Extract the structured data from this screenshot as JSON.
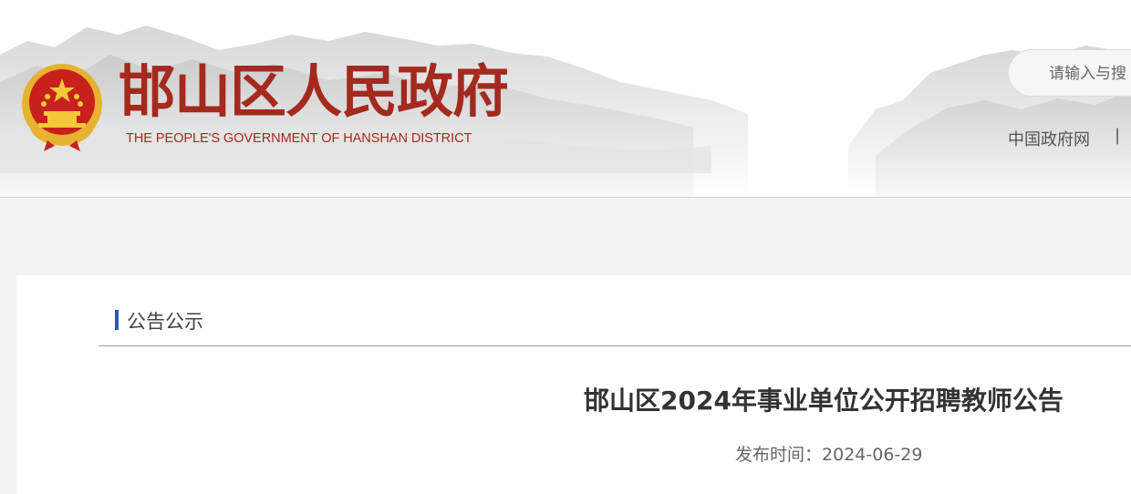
{
  "header": {
    "title": "邯山区人民政府",
    "subtitle": "THE PEOPLE'S GOVERNMENT OF HANSHAN DISTRICT",
    "emblem_icon": "national-emblem-icon",
    "brand_color": "#a4291e"
  },
  "search": {
    "placeholder": "请输入与搜"
  },
  "top_links": {
    "gov_portal": "中国政府网",
    "separator": "|"
  },
  "breadcrumb": {
    "section": "公告公示",
    "accent_color": "#1a5fc8"
  },
  "article": {
    "title": "邯山区2024年事业单位公开招聘教师公告",
    "publish_label": "发布时间：",
    "publish_date": "2024-06-29"
  }
}
